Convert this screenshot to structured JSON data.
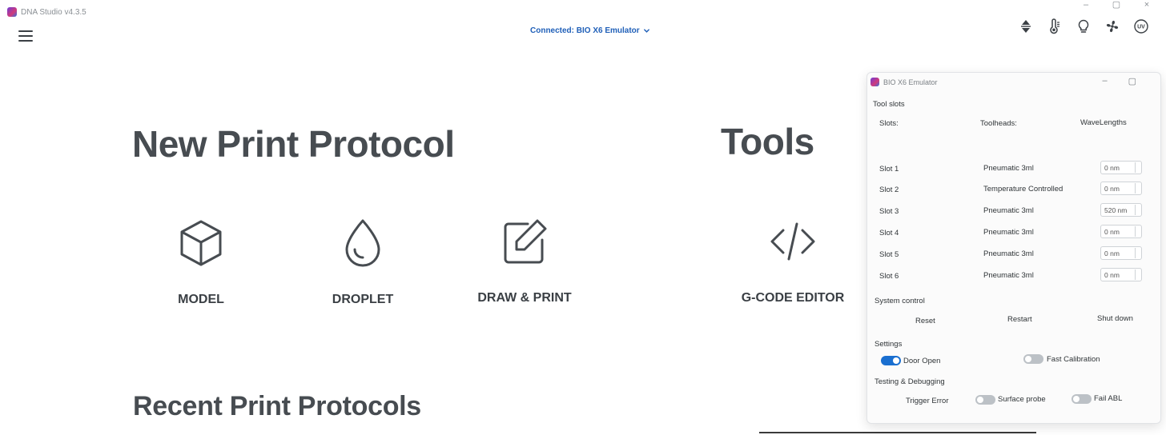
{
  "app": {
    "title": "DNA Studio v4.3.5",
    "window_controls": {
      "minimize": "–",
      "maximize": "▢",
      "close": "×"
    }
  },
  "header": {
    "connection_label": "Connected: BIO X6 Emulator",
    "icons": [
      "z-axis-arrows-icon",
      "thermometer-icon",
      "lightbulb-icon",
      "fan-icon",
      "uv-icon"
    ],
    "uv_text": "UV"
  },
  "main": {
    "new_protocol_title": "New Print Protocol",
    "tools_title": "Tools",
    "recent_title": "Recent Print Protocols",
    "tiles": [
      {
        "label": "MODEL",
        "icon": "cube-icon"
      },
      {
        "label": "DROPLET",
        "icon": "droplet-icon"
      },
      {
        "label": "DRAW & PRINT",
        "icon": "edit-icon"
      }
    ],
    "tools": [
      {
        "label": "G-CODE EDITOR",
        "icon": "code-icon"
      }
    ]
  },
  "emulator": {
    "title": "BIO X6 Emulator",
    "window_controls": {
      "minimize": "–",
      "maximize": "▢"
    },
    "tool_slots_heading": "Tool slots",
    "columns": {
      "slots": "Slots:",
      "toolheads": "Toolheads:",
      "wavelengths": "WaveLengths"
    },
    "slots": [
      {
        "name": "Slot 1",
        "toolhead": "Pneumatic 3ml",
        "wavelength": "0 nm"
      },
      {
        "name": "Slot 2",
        "toolhead": "Temperature Controlled",
        "wavelength": "0 nm"
      },
      {
        "name": "Slot 3",
        "toolhead": "Pneumatic 3ml",
        "wavelength": "520 nm"
      },
      {
        "name": "Slot 4",
        "toolhead": "Pneumatic 3ml",
        "wavelength": "0 nm"
      },
      {
        "name": "Slot 5",
        "toolhead": "Pneumatic 3ml",
        "wavelength": "0 nm"
      },
      {
        "name": "Slot 6",
        "toolhead": "Pneumatic 3ml",
        "wavelength": "0 nm"
      }
    ],
    "system_control_heading": "System control",
    "system_buttons": {
      "reset": "Reset",
      "restart": "Restart",
      "shutdown": "Shut down"
    },
    "settings_heading": "Settings",
    "settings": {
      "door_open": {
        "label": "Door Open",
        "on": true
      },
      "fast_calibration": {
        "label": "Fast Calibration",
        "on": false
      }
    },
    "testing_heading": "Testing & Debugging",
    "testing": {
      "trigger_error": "Trigger Error",
      "surface_probe": {
        "label": "Surface probe",
        "on": false
      },
      "fail_abl": {
        "label": "Fail ABL",
        "on": false
      }
    }
  },
  "colors": {
    "accent": "#1a6fd0",
    "link": "#1f5fb8",
    "heading": "#474c51"
  }
}
